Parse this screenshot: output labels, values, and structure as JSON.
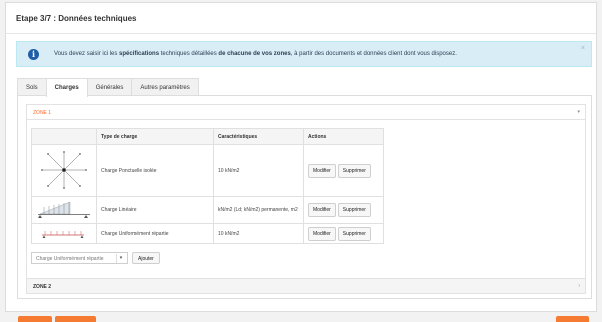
{
  "header": {
    "title": "Etape 3/7 : Données techniques"
  },
  "alert": {
    "text_before": "Vous devez saisir ici les ",
    "bold1": "spécifications",
    "text_mid": " techniques détaillées ",
    "bold2": "de chacune de vos zones",
    "text_after": ", à partir des documents et données client dont vous disposez.",
    "close": "×"
  },
  "tabs": [
    {
      "label": "Sols",
      "active": false
    },
    {
      "label": "Charges",
      "active": true
    },
    {
      "label": "Générales",
      "active": false
    },
    {
      "label": "Autres paramètres",
      "active": false
    }
  ],
  "zone1": {
    "label": "ZONE 1",
    "arrow": "▾"
  },
  "zone2": {
    "label": "ZONE 2",
    "arrow": "›"
  },
  "table": {
    "headers": {
      "type": "Type de charge",
      "car": "Caractéristiques",
      "actions": "Actions"
    },
    "rows": [
      {
        "type": "Charge Ponctuelle isolée",
        "car": "10 kN/m2",
        "edit": "Modifier",
        "delete": "Supprimer"
      },
      {
        "type": "Charge Linéaire",
        "car": "kN/m2 (Ld; kN/m2) permanente, m2",
        "edit": "Modifier",
        "delete": "Supprimer"
      },
      {
        "type": "Charge Uniformément répartie",
        "car": "10 kN/m2",
        "edit": "Modifier",
        "delete": "Supprimer"
      }
    ]
  },
  "add": {
    "select_value": "Charge Uniformément répartie",
    "caret": "▾",
    "button": "Ajouter"
  },
  "colors": {
    "accent": "#f57b32",
    "alert_bg": "#d9edf7",
    "info_icon": "#1e5fa7"
  }
}
